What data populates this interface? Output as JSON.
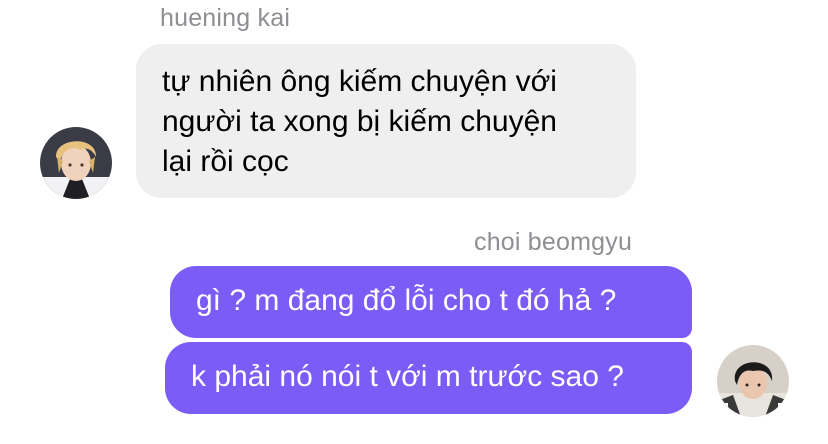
{
  "chat": {
    "incoming": {
      "sender": "huening kai",
      "avatar_icon": "blonde-person-avatar-icon",
      "lines": [
        "tự nhiên ông kiếm chuyện với",
        "người ta xong bị kiếm chuyện",
        "lại rồi cọc"
      ]
    },
    "outgoing": {
      "sender": "choi beomgyu",
      "avatar_icon": "dark-hair-person-avatar-icon",
      "messages": [
        "gì ? m đang đổ lỗi cho t đó hả ?",
        "k phải nó nói t với m trước sao ?"
      ]
    },
    "colors": {
      "incoming_bubble": "#efefef",
      "outgoing_bubble": "#7b5cf6",
      "sender_name": "#8e8e93"
    }
  }
}
